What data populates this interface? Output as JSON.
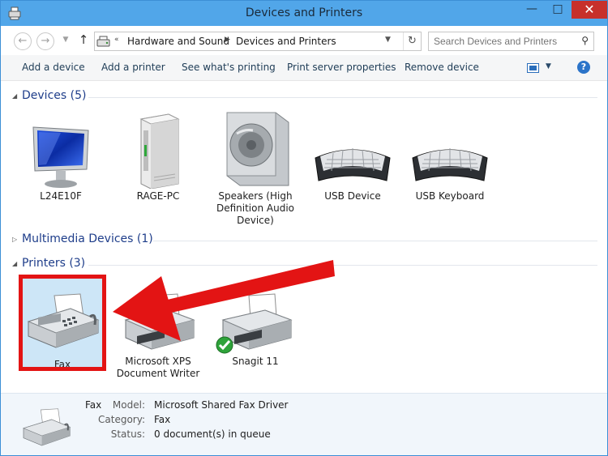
{
  "window": {
    "title": "Devices and Printers",
    "controls": {
      "minimize": "—",
      "maximize": "□",
      "close": "✕"
    }
  },
  "address": {
    "crumbs": [
      "Hardware and Sound",
      "Devices and Printers"
    ],
    "overflow": "«",
    "search_placeholder": "Search Devices and Printers"
  },
  "toolbar": {
    "add_device": "Add a device",
    "add_printer": "Add a printer",
    "see_printing": "See what's printing",
    "print_server": "Print server properties",
    "remove_device": "Remove device",
    "help": "?"
  },
  "groups": {
    "devices": "Devices (5)",
    "multimedia": "Multimedia Devices (1)",
    "printers": "Printers (3)"
  },
  "devices": [
    {
      "name": "L24E10F",
      "icon": "monitor-icon"
    },
    {
      "name": "RAGE-PC",
      "icon": "computer-tower-icon"
    },
    {
      "name": "Speakers (High Definition Audio Device)",
      "icon": "speaker-icon"
    },
    {
      "name": "USB Device",
      "icon": "keyboard-icon"
    },
    {
      "name": "USB Keyboard",
      "icon": "keyboard-icon"
    }
  ],
  "printers": [
    {
      "name": "Fax",
      "icon": "fax-icon"
    },
    {
      "name": "Microsoft XPS Document Writer",
      "icon": "printer-icon"
    },
    {
      "name": "Snagit 11",
      "icon": "printer-icon"
    }
  ],
  "details": {
    "name": "Fax",
    "model_label": "Model:",
    "model": "Microsoft Shared Fax Driver",
    "category_label": "Category:",
    "category": "Fax",
    "status_label": "Status:",
    "status": "0 document(s) in queue"
  },
  "colors": {
    "titlebar": "#51a6e9",
    "close_button": "#c7302b",
    "group_header": "#1e3d8a",
    "annotation": "#e31414",
    "selection": "#cde6f7"
  }
}
